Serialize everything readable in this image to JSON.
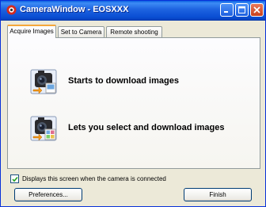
{
  "window": {
    "title": "CameraWindow - EOSXXX"
  },
  "tabs": [
    {
      "label": "Acquire Images",
      "active": true
    },
    {
      "label": "Set to Camera",
      "active": false
    },
    {
      "label": "Remote shooting",
      "active": false
    }
  ],
  "actions": [
    {
      "label": "Starts to download images",
      "icon": "camera-download-icon"
    },
    {
      "label": "Lets you select and download images",
      "icon": "camera-select-download-icon"
    }
  ],
  "startup_checkbox": {
    "label": "Displays this screen when the camera is connected",
    "checked": true
  },
  "buttons": {
    "preferences": "Preferences...",
    "finish": "Finish"
  },
  "colors": {
    "titlebar": "#0a4ed3",
    "window_bg": "#ece9d8",
    "tab_accent": "#f5a73a",
    "close_button": "#c9401c"
  }
}
